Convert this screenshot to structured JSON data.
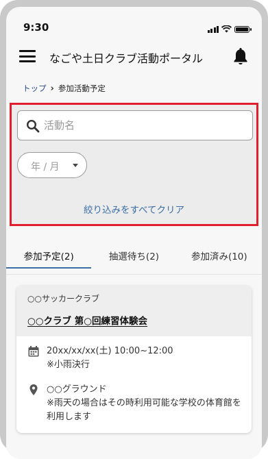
{
  "status_bar": {
    "time": "9:30"
  },
  "app_bar": {
    "title": "なごや土日クラブ活動ポータル"
  },
  "breadcrumb": {
    "home": "トップ",
    "separator": "›",
    "current": "参加活動予定"
  },
  "filters": {
    "search_placeholder": "活動名",
    "search_value": "",
    "month_placeholder": "年 / 月",
    "clear_all": "絞り込みをすべてクリア"
  },
  "tabs": [
    {
      "label": "参加予定(2)",
      "active": true
    },
    {
      "label": "抽選待ち(2)",
      "active": false
    },
    {
      "label": "参加済み(10)",
      "active": false
    }
  ],
  "activity": {
    "club": "○○サッカークラブ",
    "title": "○○クラブ 第○回練習体験会",
    "date": "20xx/xx/xx(土) 10:00~12:00",
    "weather_note": "※小雨決行",
    "location": "○○グラウンド",
    "rain_note": "※雨天の場合はその時利用可能な学校の体育館を利用します"
  },
  "colors": {
    "highlight_border": "#e01e2d",
    "link_blue": "#3b6ea5",
    "breadcrumb_link": "#2a4a8a"
  },
  "icons": [
    "menu-icon",
    "bell-icon",
    "search-icon",
    "calendar-icon",
    "location-pin-icon",
    "caret-down-icon",
    "signal-icon",
    "wifi-icon",
    "battery-icon"
  ]
}
